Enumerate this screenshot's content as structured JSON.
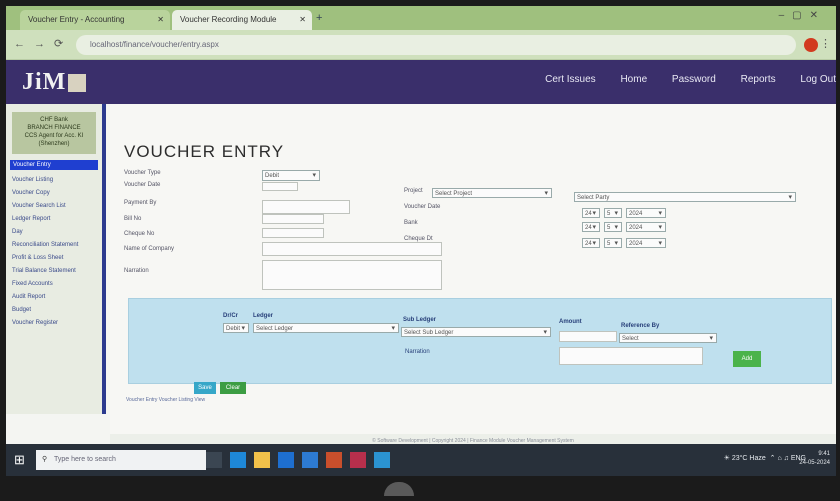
{
  "browser": {
    "tabs": [
      "Voucher Entry - Accounting",
      "Voucher Recording Module"
    ],
    "url": "localhost/finance/voucher/entry.aspx"
  },
  "header": {
    "logo": "JiM",
    "nav": [
      "Cert Issues",
      "Home",
      "Password",
      "Reports",
      "Log Out"
    ]
  },
  "sidebar": {
    "org": "CHF Bank\nBRANCH FINANCE\nCCS Agent for Acc. KI\n(Shenzhen)",
    "active": "Voucher Entry",
    "items": [
      "Voucher Listing",
      "Voucher Copy",
      "Voucher Search List",
      "Ledger Report",
      "Day",
      "Reconciliation Statement",
      "Profit & Loss Sheet",
      "Trial Balance Statement",
      "Fixed Accounts",
      "Audit Report",
      "Budget",
      "Voucher Register"
    ]
  },
  "form": {
    "title": "VOUCHER ENTRY",
    "labels": {
      "voucher_type": "Voucher Type",
      "date": "Voucher Date",
      "payment_by": "Payment By",
      "bill_no": "Bill No",
      "cheque_no": "Cheque No",
      "name_of_company": "Name of Company",
      "narration": "Narration",
      "project": "Project",
      "voucher_date2": "Voucher Date",
      "bank": "Bank",
      "cheque_dt": "Cheque Dt",
      "party": "Party"
    },
    "values": {
      "voucher_type": "Debit",
      "date": "",
      "project": "Select Project",
      "party": "Select Party",
      "d1": "24",
      "m1": "5",
      "y1": "2024",
      "d2": "24",
      "m2": "5",
      "y2": "2024",
      "d3": "24",
      "m3": "5",
      "y3": "2024"
    }
  },
  "panel": {
    "labels": {
      "drcr": "Dr/Cr",
      "ledger": "Ledger",
      "subledger": "Sub Ledger",
      "amount": "Amount",
      "reference": "Reference By",
      "narration": "Narration"
    },
    "values": {
      "drcr": "Debit",
      "ledger": "Select Ledger",
      "subledger": "Select Sub Ledger",
      "reference": "Select"
    },
    "add_label": "Add"
  },
  "buttons": {
    "save": "Save",
    "clear": "Clear"
  },
  "info_text": "Voucher Entry   Voucher Listing View",
  "footer": "© Software Development | Copyright 2024 | Finance Module Voucher Management System",
  "taskbar": {
    "search_placeholder": "Type here to search",
    "weather": "23°C Haze",
    "time": "9:41",
    "date": "24-05-2024",
    "lang": "ENG"
  }
}
